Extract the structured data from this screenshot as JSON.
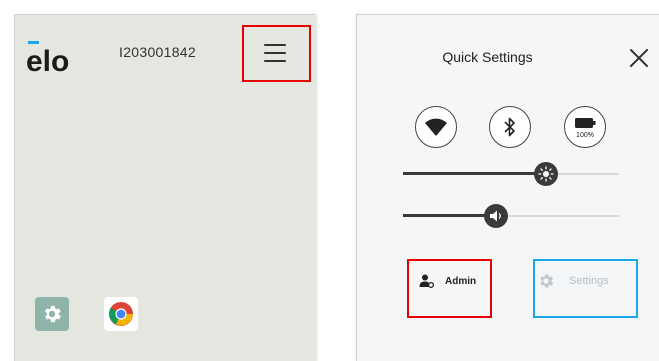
{
  "home": {
    "brand": "elo",
    "serial_number": "I203001842",
    "apps": [
      {
        "icon": "gear-icon"
      },
      {
        "icon": "chrome-icon"
      }
    ]
  },
  "quick_settings": {
    "title": "Quick Settings",
    "toggles": [
      {
        "icon": "wifi-icon"
      },
      {
        "icon": "bluetooth-icon"
      },
      {
        "icon": "battery-icon",
        "label": "100%"
      }
    ],
    "brightness_level": 0.66,
    "volume_level": 0.43,
    "admin_label": "Admin",
    "settings_label": "Settings"
  },
  "colors": {
    "highlight_red": "#e60000",
    "highlight_blue": "#1aa7e8",
    "home_background": "#e4e6e0",
    "settings_app_tile": "#8fb5aa"
  }
}
